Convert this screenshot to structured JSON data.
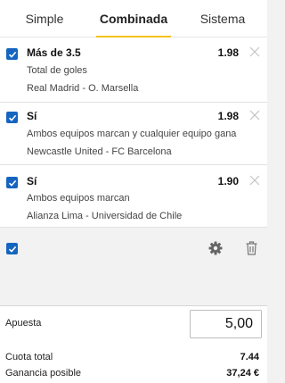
{
  "tabs": [
    {
      "label": "Simple",
      "active": false
    },
    {
      "label": "Combinada",
      "active": true
    },
    {
      "label": "Sistema",
      "active": false
    }
  ],
  "bets": [
    {
      "selection": "Más de 3.5",
      "odds": "1.98",
      "market": "Total de goles",
      "match": "Real Madrid - O. Marsella",
      "checked": true
    },
    {
      "selection": "Sí",
      "odds": "1.98",
      "market": "Ambos equipos marcan y cualquier equipo gana",
      "match": "Newcastle United - FC Barcelona",
      "checked": true
    },
    {
      "selection": "Sí",
      "odds": "1.90",
      "market": "Ambos equipos marcan",
      "match": "Alianza Lima - Universidad de Chile",
      "checked": true
    }
  ],
  "toolbar": {
    "select_all_checked": true,
    "settings_icon": "gear-icon",
    "delete_icon": "trash-icon"
  },
  "footer": {
    "stake_label": "Apuesta",
    "stake_value": "5,00",
    "total_odds_label": "Cuota total",
    "total_odds_value": "7.44",
    "potential_win_label": "Ganancia posible",
    "potential_win_value": "37,24 €"
  },
  "colors": {
    "accent": "#f3c21b",
    "checkbox": "#1565c0",
    "background": "#f2f2f2"
  }
}
